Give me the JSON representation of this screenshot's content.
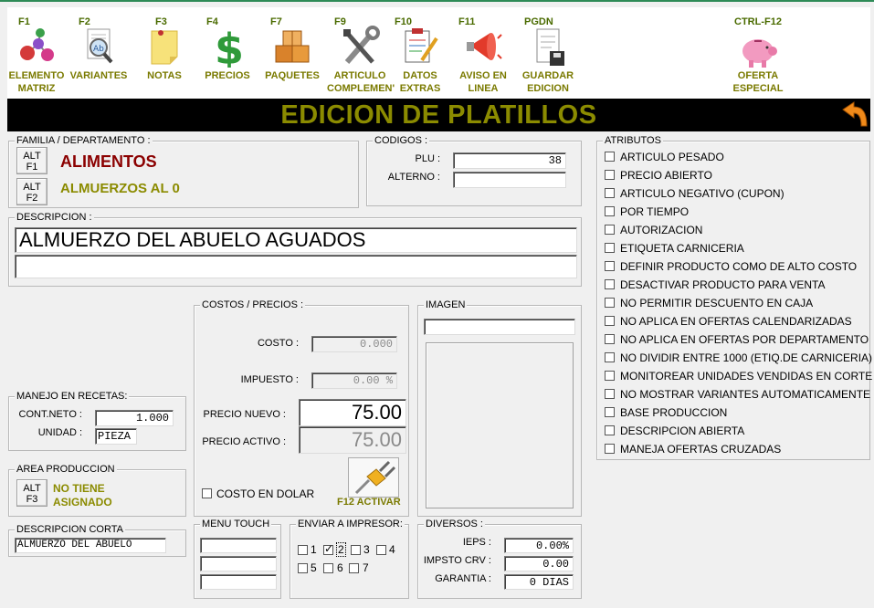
{
  "toolbar": [
    {
      "key": "F1",
      "label": "ELEMENTO\nMATRIZ",
      "icon": "molecule-icon"
    },
    {
      "key": "F2",
      "label": "VARIANTES",
      "icon": "magnifier-document-icon"
    },
    {
      "key": "F3",
      "label": "NOTAS",
      "icon": "sticky-note-icon"
    },
    {
      "key": "F4",
      "label": "PRECIOS",
      "icon": "dollar-icon"
    },
    {
      "key": "F7",
      "label": "PAQUETES",
      "icon": "boxes-icon"
    },
    {
      "key": "F9",
      "label": "ARTICULO\nCOMPLEMEN'",
      "icon": "tools-icon"
    },
    {
      "key": "F10",
      "label": "DATOS\nEXTRAS",
      "icon": "clipboard-icon"
    },
    {
      "key": "F11",
      "label": "AVISO EN\nLINEA",
      "icon": "megaphone-icon"
    },
    {
      "key": "PGDN",
      "label": "GUARDAR\nEDICION",
      "icon": "save-document-icon"
    },
    {
      "key": "CTRL-F12",
      "label": "OFERTA\nESPECIAL",
      "icon": "piggy-bank-icon"
    }
  ],
  "title": "EDICION DE PLATILLOS",
  "familia": {
    "label": "FAMILIA / DEPARTAMENTO :",
    "family_btn": "ALT\nF1",
    "family_value": "ALIMENTOS",
    "dept_btn": "ALT\nF2",
    "dept_value": "ALMUERZOS AL 0"
  },
  "codigos": {
    "label": "CODIGOS :",
    "plu_label": "PLU :",
    "plu_value": "38",
    "alterno_label": "ALTERNO :",
    "alterno_value": ""
  },
  "descripcion": {
    "label": "DESCRIPCION :",
    "line1": "ALMUERZO DEL ABUELO AGUADOS",
    "line2": ""
  },
  "costos": {
    "label": "COSTOS / PRECIOS :",
    "costo_label": "COSTO :",
    "costo_value": "0.000",
    "impuesto_label": "IMPUESTO :",
    "impuesto_value": "0.00 %",
    "precio_nuevo_label": "PRECIO NUEVO :",
    "precio_nuevo_value": "75.00",
    "precio_activo_label": "PRECIO ACTIVO :",
    "precio_activo_value": "75.00",
    "costo_dolar_label": "COSTO EN DOLAR",
    "activar_label": "F12 ACTIVAR"
  },
  "imagen": {
    "label": "IMAGEN",
    "path_value": ""
  },
  "recetas": {
    "label": "MANEJO EN RECETAS:",
    "contneto_label": "CONT.NETO :",
    "contneto_value": "1.000",
    "unidad_label": "UNIDAD :",
    "unidad_value": "PIEZA"
  },
  "area": {
    "label": "AREA PRODUCCION",
    "btn": "ALT\nF3",
    "value": "NO TIENE\nASIGNADO"
  },
  "desc_corta": {
    "label": "DESCRIPCION CORTA",
    "value": "ALMUERZO DEL ABUELO"
  },
  "menu_touch": {
    "label": "MENU TOUCH"
  },
  "impresor": {
    "label": "ENVIAR A IMPRESOR:",
    "options": [
      {
        "n": "1",
        "checked": false
      },
      {
        "n": "2",
        "checked": true
      },
      {
        "n": "3",
        "checked": false
      },
      {
        "n": "4",
        "checked": false
      },
      {
        "n": "5",
        "checked": false
      },
      {
        "n": "6",
        "checked": false
      },
      {
        "n": "7",
        "checked": false
      }
    ]
  },
  "diversos": {
    "label": "DIVERSOS :",
    "ieps_label": "IEPS :",
    "ieps_value": "0.00%",
    "impsto_label": "IMPSTO CRV :",
    "impsto_value": "0.00",
    "garantia_label": "GARANTIA :",
    "garantia_value": "0 DIAS"
  },
  "atributos": {
    "label": "ATRIBUTOS",
    "items": [
      "ARTICULO PESADO",
      "PRECIO ABIERTO",
      "ARTICULO NEGATIVO (CUPON)",
      "POR TIEMPO",
      "AUTORIZACION",
      "ETIQUETA CARNICERIA",
      "DEFINIR PRODUCTO COMO DE ALTO COSTO",
      "DESACTIVAR PRODUCTO PARA VENTA",
      "NO PERMITIR DESCUENTO EN CAJA",
      "NO APLICA EN OFERTAS CALENDARIZADAS",
      "NO APLICA EN OFERTAS POR DEPARTAMENTO",
      "NO DIVIDIR ENTRE 1000 (ETIQ.DE CARNICERIA)",
      "MONITOREAR UNIDADES VENDIDAS EN CORTE Z",
      "NO MOSTRAR VARIANTES AUTOMATICAMENTE",
      "BASE PRODUCCION",
      "DESCRIPCION ABIERTA",
      "MANEJA OFERTAS CRUZADAS"
    ]
  },
  "colors": {
    "accent_text": "#8b8b00",
    "family_red": "#8b0000",
    "toolbar_key": "#4a6b00"
  }
}
